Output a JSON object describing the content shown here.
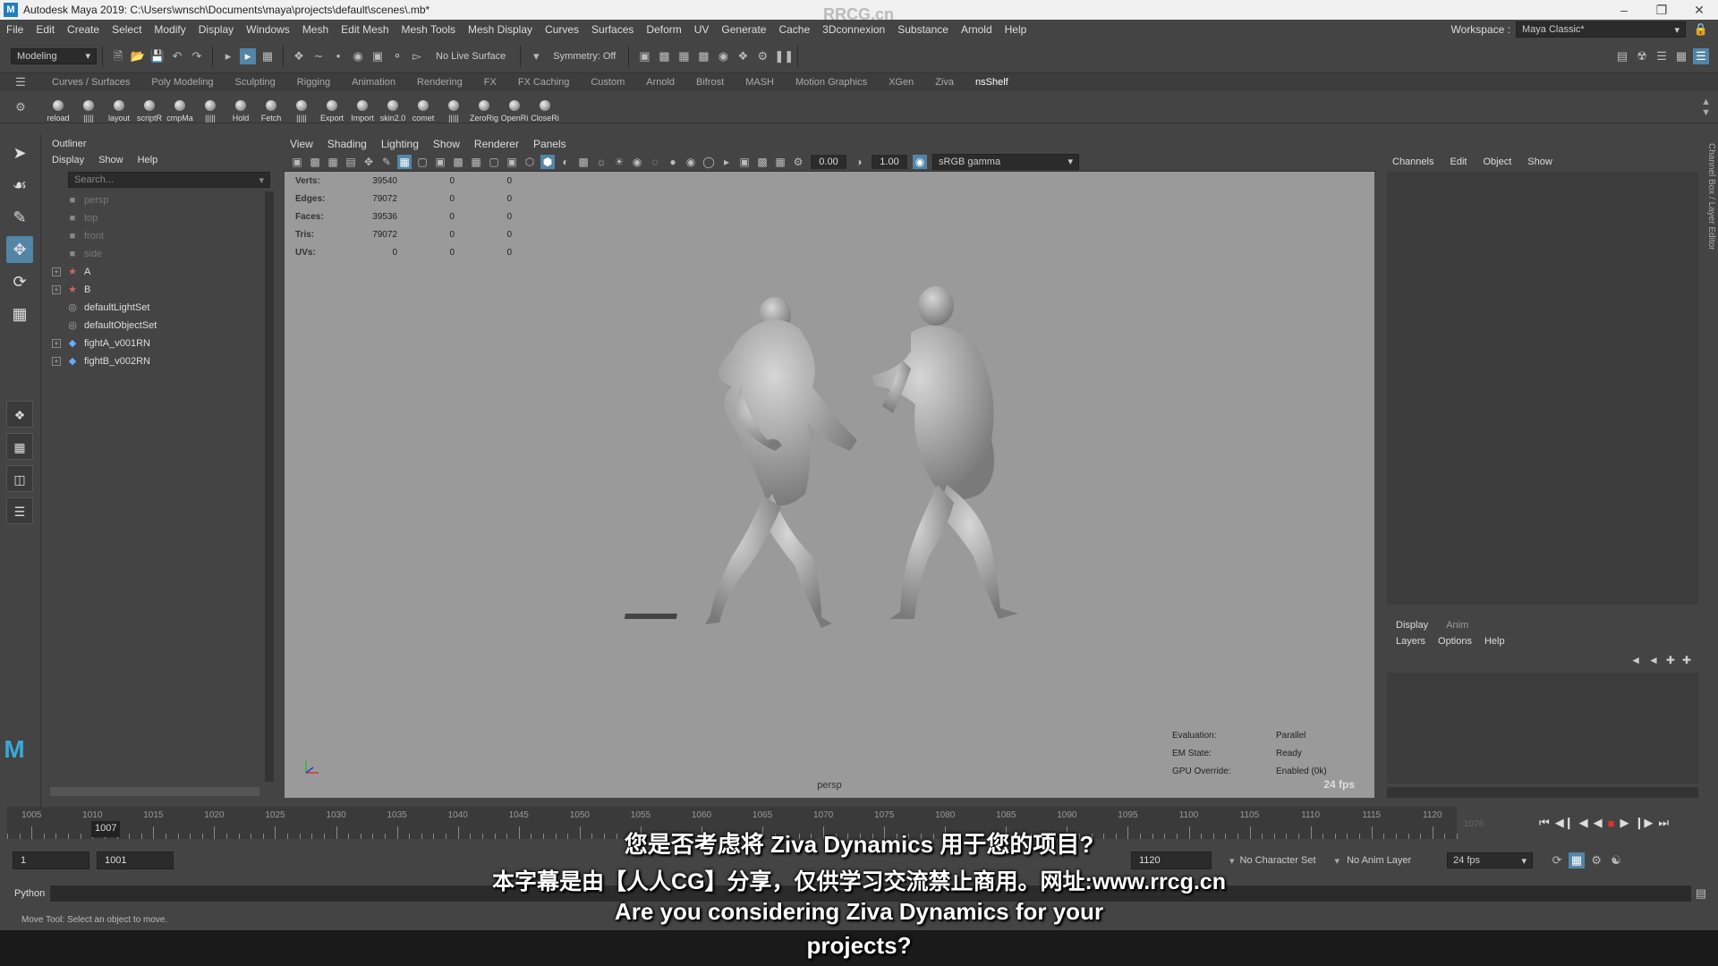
{
  "titlebar": {
    "title": "Autodesk Maya 2019: C:\\Users\\wnsch\\Documents\\maya\\projects\\default\\scenes\\.mb*",
    "watermark": "RRCG.cn"
  },
  "menubar": {
    "items": [
      "File",
      "Edit",
      "Create",
      "Select",
      "Modify",
      "Display",
      "Windows",
      "Mesh",
      "Edit Mesh",
      "Mesh Tools",
      "Mesh Display",
      "Curves",
      "Surfaces",
      "Deform",
      "UV",
      "Generate",
      "Cache",
      "3Dconnexion",
      "Substance",
      "Arnold",
      "Help"
    ],
    "workspace_label": "Workspace :",
    "workspace_value": "Maya Classic*"
  },
  "statusline": {
    "mode": "Modeling",
    "live_surface": "No Live Surface",
    "symmetry": "Symmetry: Off"
  },
  "shelf": {
    "tabs": [
      "Curves / Surfaces",
      "Poly Modeling",
      "Sculpting",
      "Rigging",
      "Animation",
      "Rendering",
      "FX",
      "FX Caching",
      "Custom",
      "Arnold",
      "Bifrost",
      "MASH",
      "Motion Graphics",
      "XGen",
      "Ziva",
      "nsShelf"
    ],
    "active_tab": "nsShelf",
    "buttons": [
      "reload",
      "|||||",
      "layout",
      "scriptR",
      "cmpMa",
      "|||||",
      "Hold",
      "Fetch",
      "|||||",
      "Export",
      "Import",
      "skin2.0",
      "comet",
      "|||||",
      "ZeroRig",
      "OpenRi",
      "CloseRi"
    ]
  },
  "outliner": {
    "title": "Outliner",
    "menu": [
      "Display",
      "Show",
      "Help"
    ],
    "search_placeholder": "Search...",
    "items": [
      {
        "label": "persp",
        "dim": true,
        "expandable": false,
        "icon": "camera-icon"
      },
      {
        "label": "top",
        "dim": true,
        "expandable": false,
        "icon": "camera-icon"
      },
      {
        "label": "front",
        "dim": true,
        "expandable": false,
        "icon": "camera-icon"
      },
      {
        "label": "side",
        "dim": true,
        "expandable": false,
        "icon": "camera-icon"
      },
      {
        "label": "A",
        "dim": false,
        "expandable": true,
        "icon": "joint-icon"
      },
      {
        "label": "B",
        "dim": false,
        "expandable": true,
        "icon": "joint-icon"
      },
      {
        "label": "defaultLightSet",
        "dim": false,
        "expandable": false,
        "icon": "set-icon"
      },
      {
        "label": "defaultObjectSet",
        "dim": false,
        "expandable": false,
        "icon": "set-icon"
      },
      {
        "label": "fightA_v001RN",
        "dim": false,
        "expandable": true,
        "icon": "reference-icon"
      },
      {
        "label": "fightB_v002RN",
        "dim": false,
        "expandable": true,
        "icon": "reference-icon"
      }
    ]
  },
  "viewport": {
    "menu": [
      "View",
      "Shading",
      "Lighting",
      "Show",
      "Renderer",
      "Panels"
    ],
    "exposure": "0.00",
    "gamma": "1.00",
    "colorspace": "sRGB gamma",
    "hud": [
      {
        "k": "Verts:",
        "a": "39540",
        "b": "0",
        "c": "0"
      },
      {
        "k": "Edges:",
        "a": "79072",
        "b": "0",
        "c": "0"
      },
      {
        "k": "Faces:",
        "a": "39536",
        "b": "0",
        "c": "0"
      },
      {
        "k": "Tris:",
        "a": "79072",
        "b": "0",
        "c": "0"
      },
      {
        "k": "UVs:",
        "a": "0",
        "b": "0",
        "c": "0"
      }
    ],
    "hud2": [
      {
        "k": "Evaluation:",
        "v": "Parallel"
      },
      {
        "k": "EM State:",
        "v": "Ready"
      },
      {
        "k": "GPU Override:",
        "v": "Enabled (0k)"
      }
    ],
    "fps": "24 fps",
    "camera": "persp"
  },
  "channelbox": {
    "menu": [
      "Channels",
      "Edit",
      "Object",
      "Show"
    ],
    "side_label": "Channel Box / Layer Editor",
    "layer_tabs": [
      "Display",
      "Anim"
    ],
    "layer_menu": [
      "Layers",
      "Options",
      "Help"
    ]
  },
  "timeslider": {
    "labels": [
      "1005",
      "1010",
      "1015",
      "1020",
      "1025",
      "1030",
      "1035",
      "1040",
      "1045",
      "1050",
      "1055",
      "1060",
      "1065",
      "1070",
      "1075",
      "1080",
      "1085",
      "1090",
      "1095",
      "1100",
      "1105",
      "1110",
      "1115",
      "1120"
    ],
    "current_frame": "1007",
    "current_frame_right": "1076"
  },
  "range": {
    "start": "1",
    "playback_start": "1001",
    "playback_end": "1120",
    "end": "1120",
    "character_set": "No Character Set",
    "anim_layer": "No Anim Layer",
    "fps": "24 fps"
  },
  "cmdline": {
    "label": "Python"
  },
  "helpline": {
    "text": "Move Tool: Select an object to move."
  },
  "subtitles": {
    "line1": "您是否考虑将 Ziva Dynamics 用于您的项目?",
    "line2": "本字幕是由【人人CG】分享，仅供学习交流禁止商用。网址:www.rrcg.cn",
    "line3": "Are you considering Ziva Dynamics for your",
    "line4": "projects?"
  }
}
